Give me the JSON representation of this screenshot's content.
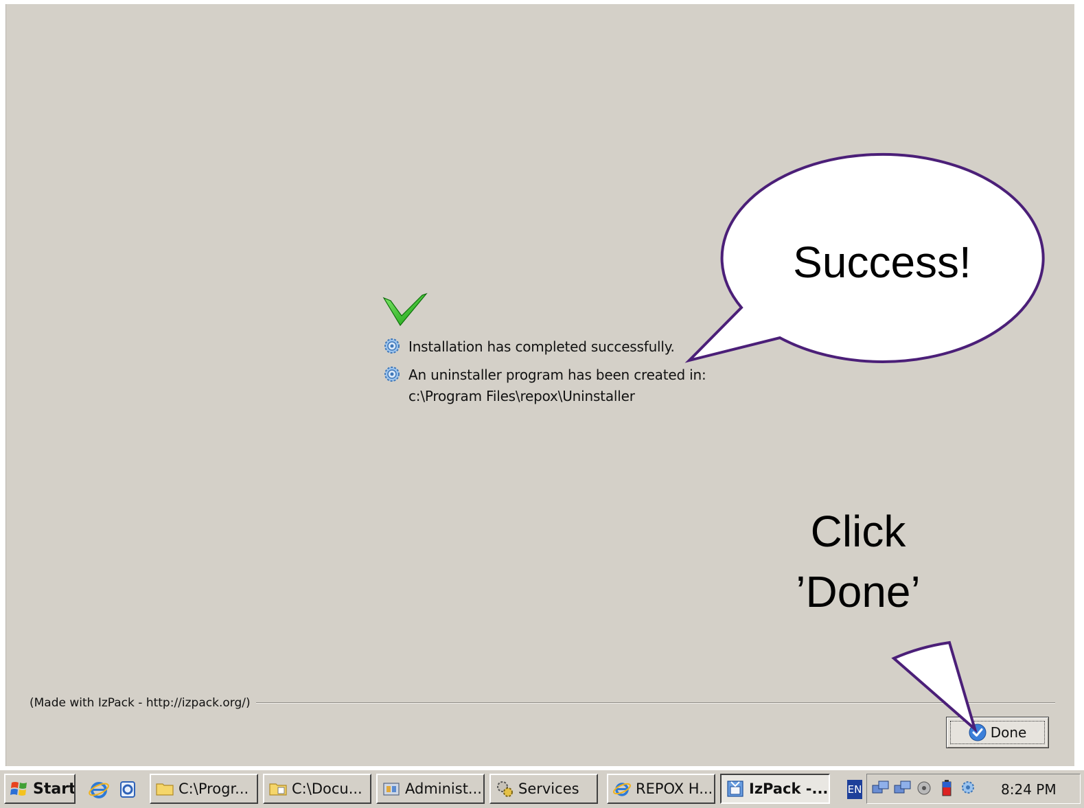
{
  "panel": {
    "messages": [
      {
        "text": "Installation has completed successfully."
      },
      {
        "text": "An uninstaller program has been created in:",
        "detail": "c:\\Program Files\\repox\\Uninstaller"
      }
    ],
    "credit": "(Made with IzPack - http://izpack.org/)",
    "done_label": "Done"
  },
  "callouts": {
    "success": "Success!",
    "done_line1": "Click",
    "done_line2": "’Done’"
  },
  "taskbar": {
    "start_label": "Start",
    "windows": [
      {
        "label": "C:\\Progr...",
        "icon": "folder-icon"
      },
      {
        "label": "C:\\Docu...",
        "icon": "folder-icon"
      },
      {
        "label": "Administ...",
        "icon": "admin-tools-icon"
      },
      {
        "label": "Services",
        "icon": "services-gear-icon"
      },
      {
        "label": "REPOX H...",
        "icon": "internet-explorer-icon"
      },
      {
        "label": "IzPack -...",
        "icon": "izpack-icon",
        "active": true
      }
    ],
    "language": "EN",
    "clock": "8:24 PM"
  },
  "colors": {
    "panel_bg": "#d4d0c8",
    "callout_border": "#4b1f78",
    "checkmark": "#2fc21f"
  }
}
